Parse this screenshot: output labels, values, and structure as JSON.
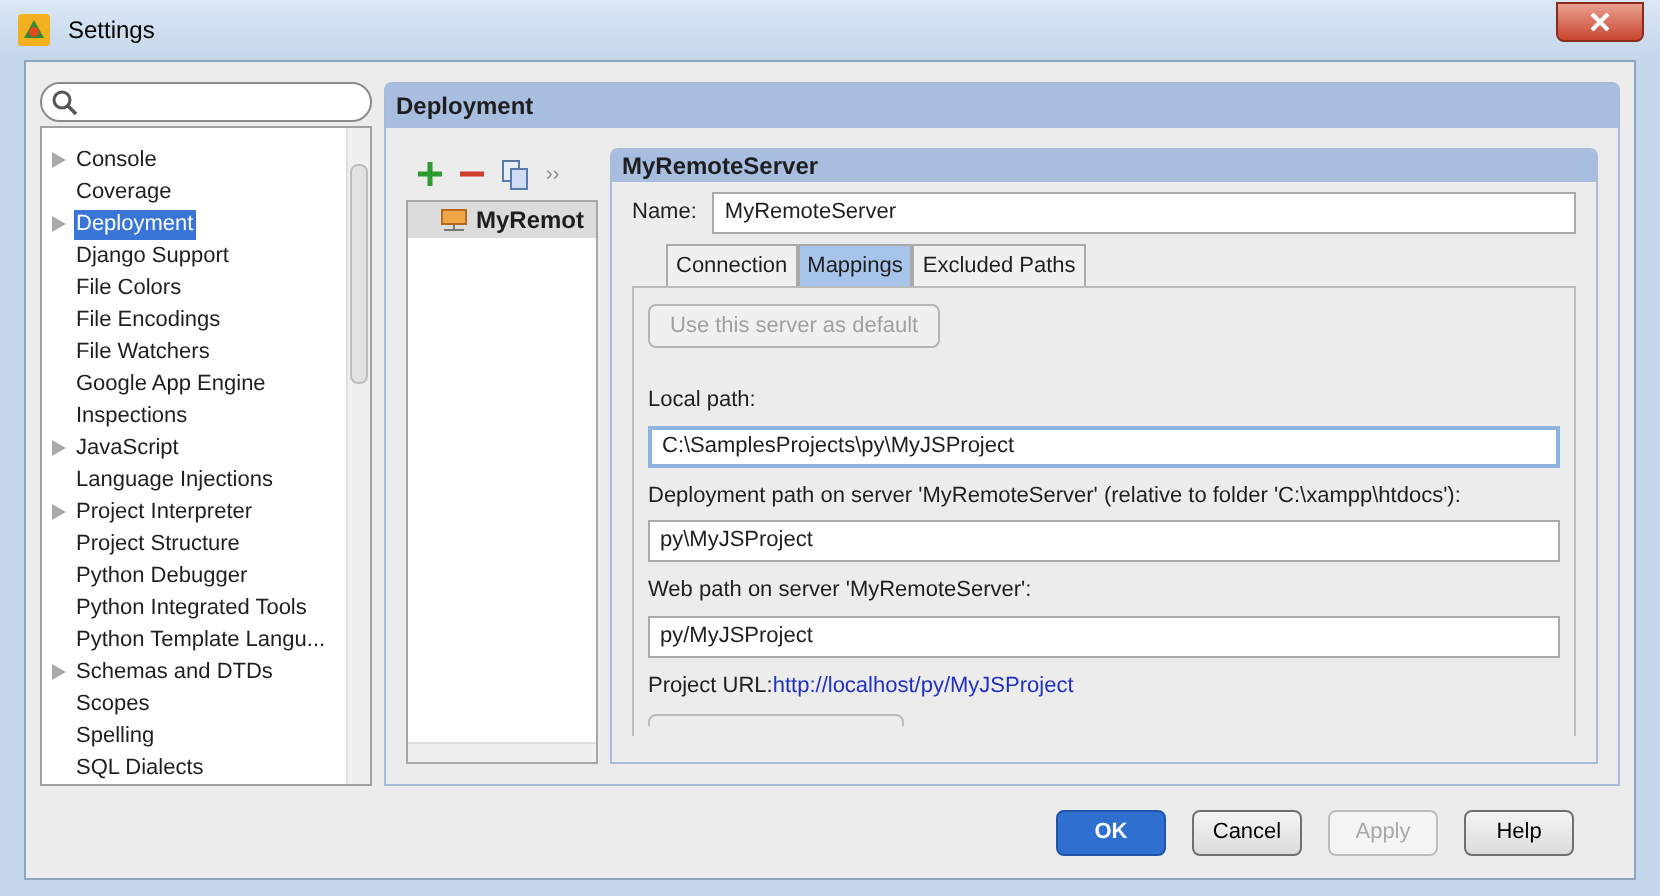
{
  "window": {
    "title": "Settings"
  },
  "sidebar": {
    "items": [
      {
        "label": "Console",
        "expandable": true,
        "selected": false
      },
      {
        "label": "Coverage",
        "expandable": false,
        "selected": false
      },
      {
        "label": "Deployment",
        "expandable": true,
        "selected": true
      },
      {
        "label": "Django Support",
        "expandable": false,
        "selected": false
      },
      {
        "label": "File Colors",
        "expandable": false,
        "selected": false
      },
      {
        "label": "File Encodings",
        "expandable": false,
        "selected": false
      },
      {
        "label": "File Watchers",
        "expandable": false,
        "selected": false
      },
      {
        "label": "Google App Engine",
        "expandable": false,
        "selected": false
      },
      {
        "label": "Inspections",
        "expandable": false,
        "selected": false
      },
      {
        "label": "JavaScript",
        "expandable": true,
        "selected": false
      },
      {
        "label": "Language Injections",
        "expandable": false,
        "selected": false
      },
      {
        "label": "Project Interpreter",
        "expandable": true,
        "selected": false
      },
      {
        "label": "Project Structure",
        "expandable": false,
        "selected": false
      },
      {
        "label": "Python Debugger",
        "expandable": false,
        "selected": false
      },
      {
        "label": "Python Integrated Tools",
        "expandable": false,
        "selected": false
      },
      {
        "label": "Python Template Langu...",
        "expandable": false,
        "selected": false
      },
      {
        "label": "Schemas and DTDs",
        "expandable": true,
        "selected": false
      },
      {
        "label": "Scopes",
        "expandable": false,
        "selected": false
      },
      {
        "label": "Spelling",
        "expandable": false,
        "selected": false
      },
      {
        "label": "SQL Dialects",
        "expandable": false,
        "selected": false
      }
    ]
  },
  "page": {
    "title": "Deployment"
  },
  "servers": {
    "toolbar_more": "››",
    "items": [
      {
        "name": "MyRemot",
        "selected": true
      }
    ]
  },
  "server": {
    "title": "MyRemoteServer",
    "name_label": "Name:",
    "name_value": "MyRemoteServer",
    "tabs": [
      {
        "label": "Connection",
        "selected": false
      },
      {
        "label": "Mappings",
        "selected": true
      },
      {
        "label": "Excluded Paths",
        "selected": false
      }
    ],
    "default_button": {
      "label": "Use this server as default",
      "disabled": true
    },
    "fields": [
      {
        "label": "Local path:",
        "value": "C:\\SamplesProjects\\py\\MyJSProject",
        "focused": true
      },
      {
        "label": "Deployment path on server 'MyRemoteServer' (relative to folder 'C:\\xampp\\htdocs'):",
        "value": "py\\MyJSProject",
        "focused": false
      },
      {
        "label": "Web path on server 'MyRemoteServer':",
        "value": "py/MyJSProject",
        "focused": false
      }
    ],
    "project_url": {
      "label": "Project URL:",
      "link": "http://localhost/py/MyJSProject"
    }
  },
  "buttons": [
    {
      "label": "OK",
      "kind": "default",
      "disabled": false
    },
    {
      "label": "Cancel",
      "kind": "normal",
      "disabled": false
    },
    {
      "label": "Apply",
      "kind": "normal",
      "disabled": true
    },
    {
      "label": "Help",
      "kind": "normal",
      "disabled": false
    }
  ]
}
